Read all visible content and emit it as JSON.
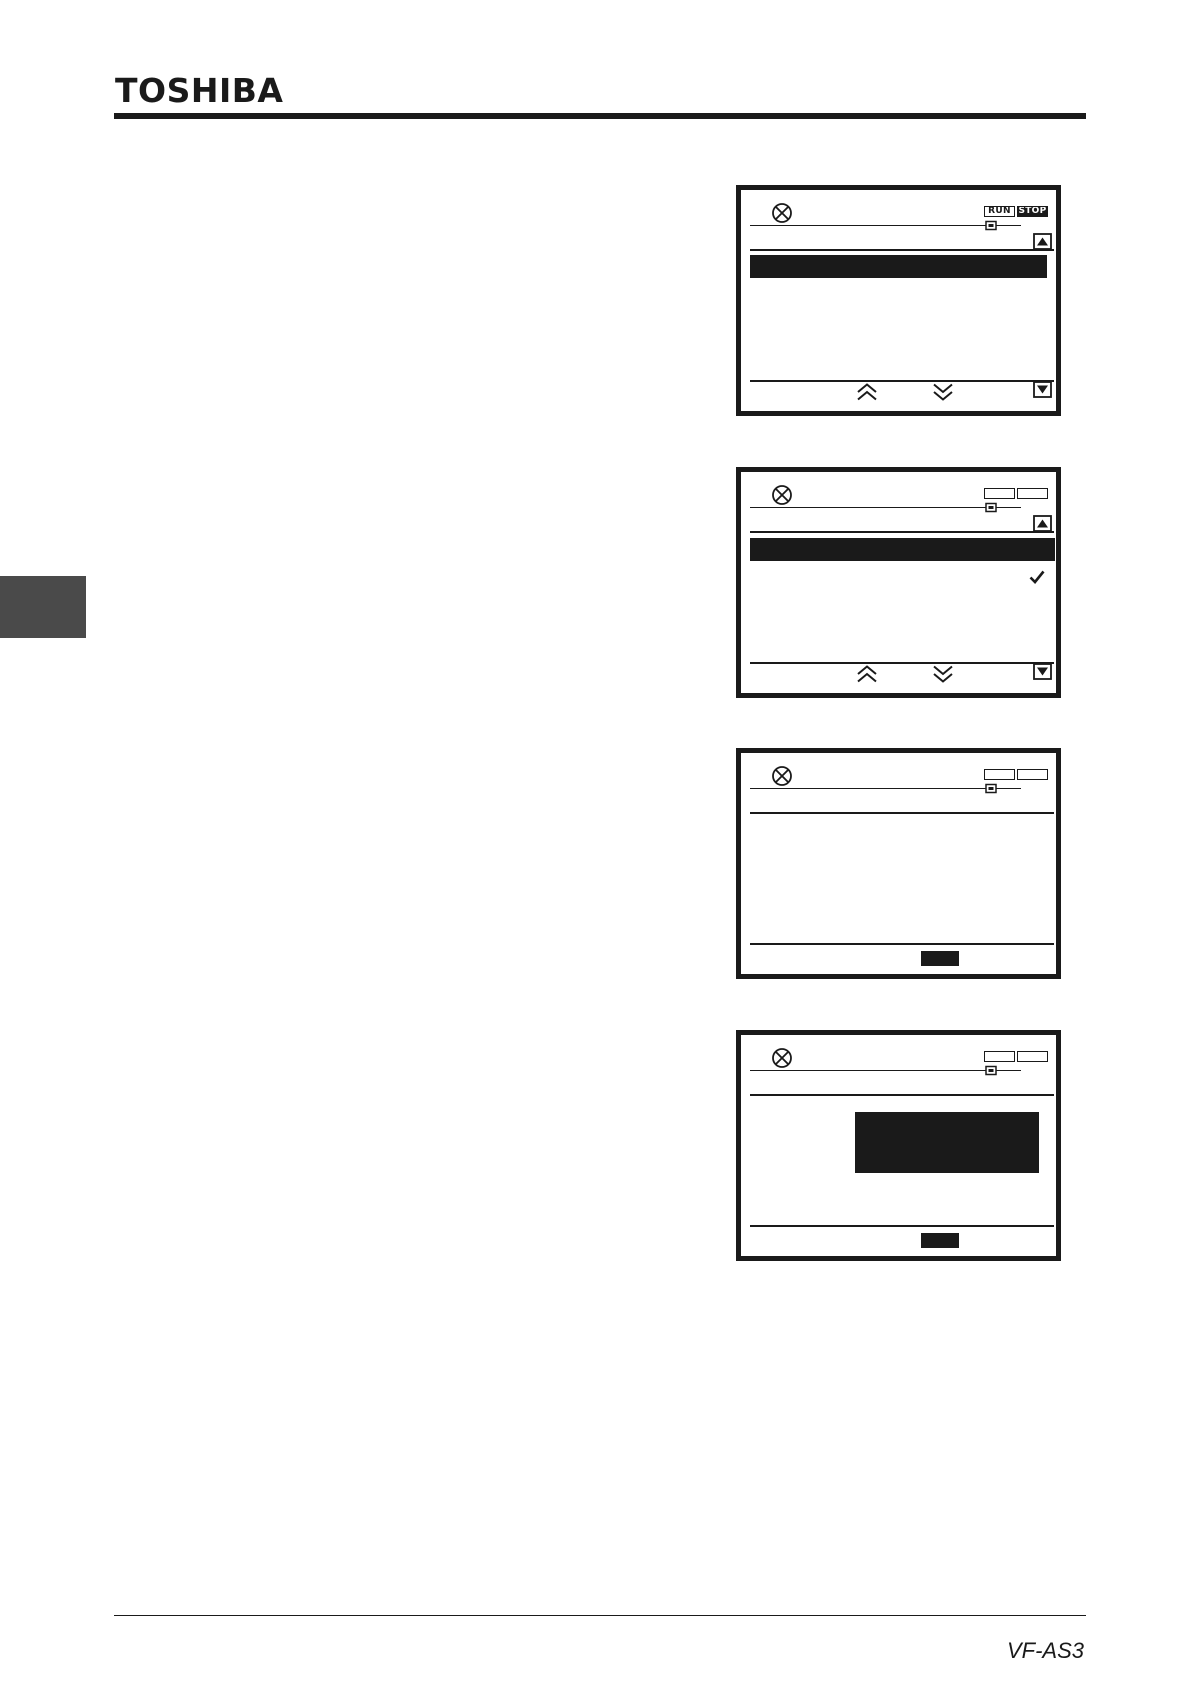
{
  "header": {
    "brand": "TOSHIBA"
  },
  "footer": {
    "model": "VF-AS3"
  },
  "screens": [
    {
      "run_label": "RUN",
      "stop_label": "STOP"
    },
    {
      "run_label": "",
      "stop_label": ""
    },
    {
      "run_label": "",
      "stop_label": ""
    },
    {
      "run_label": "",
      "stop_label": ""
    }
  ],
  "icons": {
    "status": "cross-circle-icon",
    "connector": "connector-icon",
    "scroll_up": "triangle-up-icon",
    "scroll_down": "triangle-down-icon",
    "nav_up": "double-chevron-up-icon",
    "nav_down": "double-chevron-down-icon",
    "check": "check-icon"
  }
}
